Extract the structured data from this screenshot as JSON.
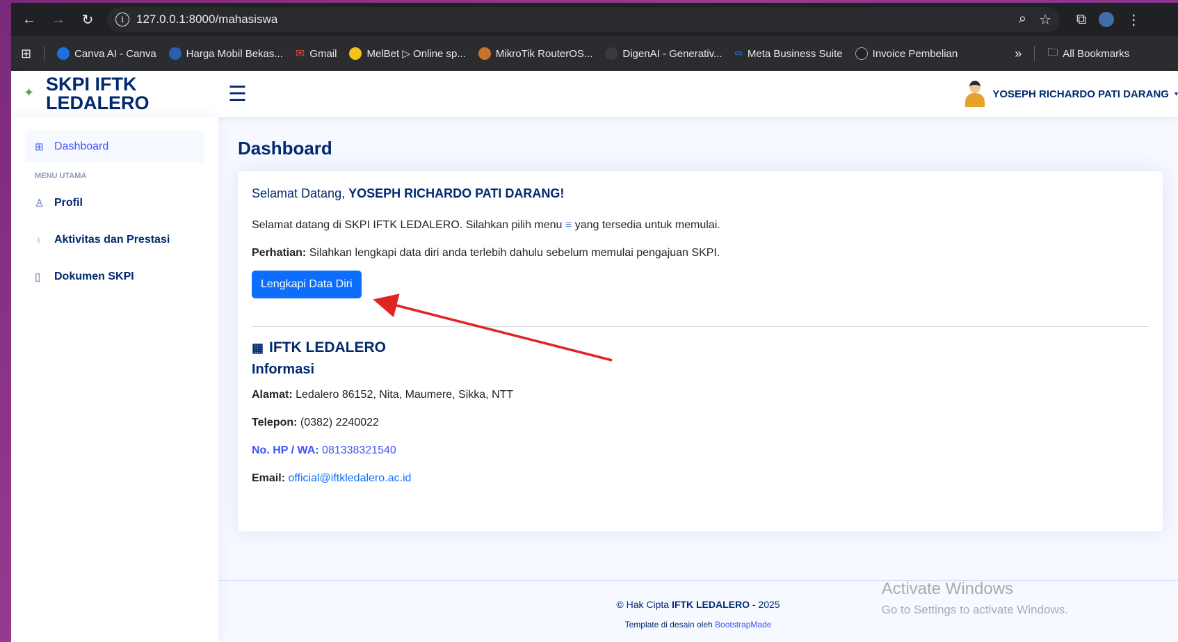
{
  "browser": {
    "url": "127.0.0.1:8000/mahasiswa",
    "bookmarks": [
      {
        "label": "Canva AI - Canva",
        "color": "#1f6fe0"
      },
      {
        "label": "Harga Mobil Bekas...",
        "color": "#2a5fb0"
      },
      {
        "label": "Gmail",
        "color": "#ea4335"
      },
      {
        "label": "MelBet ▷ Online sp...",
        "color": "#f6c21c"
      },
      {
        "label": "MikroTik RouterOS...",
        "color": "#c9722c"
      },
      {
        "label": "DigenAI - Generativ...",
        "color": "#3b3b3b"
      },
      {
        "label": "Meta Business Suite",
        "color": "#1877f2"
      },
      {
        "label": "Invoice Pembelian",
        "color": "#222222"
      }
    ],
    "more_label": "»",
    "all_bookmarks": "All Bookmarks"
  },
  "header": {
    "brand": "SKPI IFTK LEDALERO",
    "user_name": "YOSEPH RICHARDO PATI DARANG"
  },
  "sidebar": {
    "dashboard": "Dashboard",
    "heading": "MENU UTAMA",
    "items": [
      "Profil",
      "Aktivitas dan Prestasi",
      "Dokumen SKPI"
    ]
  },
  "main": {
    "title": "Dashboard",
    "welcome_prefix": "Selamat Datang, ",
    "welcome_name": "YOSEPH RICHARDO PATI DARANG!",
    "intro_a": "Selamat datang di SKPI IFTK LEDALERO. Silahkan pilih menu",
    "intro_b": "yang tersedia untuk memulai.",
    "notice_label": "Perhatian:",
    "notice_text": " Silahkan lengkapi data diri anda terlebih dahulu sebelum memulai pengajuan SKPI.",
    "button": "Lengkapi Data Diri",
    "org_name": "IFTK LEDALERO",
    "info_title": "Informasi",
    "address_label": "Alamat:",
    "address_value": " Ledalero 86152, Nita, Maumere, Sikka, NTT",
    "phone_label": "Telepon:",
    "phone_value": " (0382) 2240022",
    "hp_label": "No. HP / WA:",
    "hp_value": " 081338321540",
    "email_label": "Email:",
    "email_value": "official@iftkledalero.ac.id"
  },
  "footer": {
    "copy_prefix": "© Hak Cipta ",
    "copy_org": "IFTK LEDALERO",
    "copy_suffix": " - 2025",
    "credit_prefix": "Template di desain oleh ",
    "credit_link": "BootstrapMade"
  },
  "watermark": {
    "title": "Activate Windows",
    "subtitle": "Go to Settings to activate Windows."
  },
  "colors": {
    "primary": "#012970",
    "accent": "#4154f1",
    "button": "#0d6efd",
    "annotation_arrow": "#e02424"
  }
}
